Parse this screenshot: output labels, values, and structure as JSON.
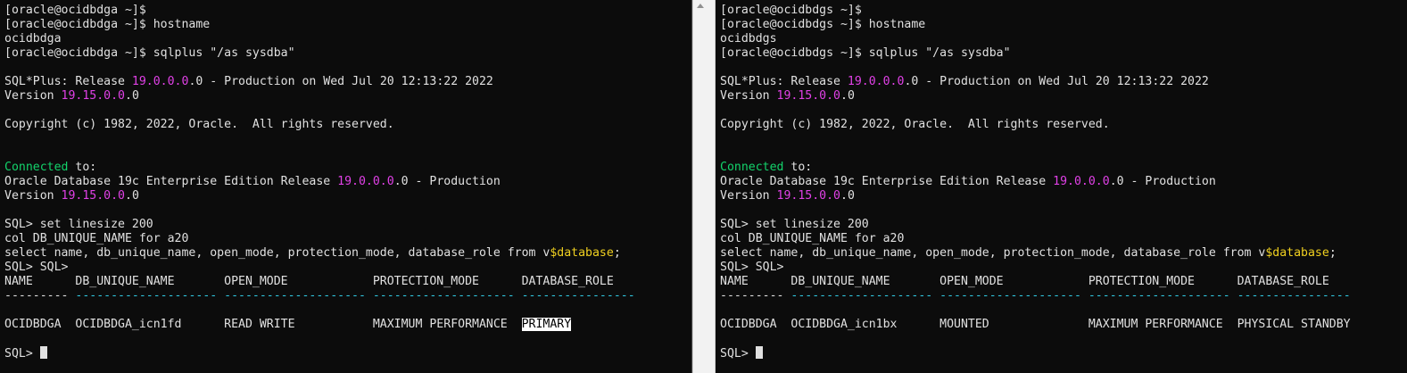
{
  "colors": {
    "background": "#0c0c0c",
    "text": "#e0e0e0",
    "connected": "#13d36b",
    "version_number": "#e040e6",
    "database_variable": "#f0d020",
    "separator": "#30c8e0",
    "selection": "#ffffff"
  },
  "left": {
    "prompt_empty": "[oracle@ocidbdga ~]$",
    "prompt_hostname": "[oracle@ocidbdga ~]$ hostname",
    "hostname_output": "ocidbdga",
    "prompt_sqlplus": "[oracle@ocidbdga ~]$ sqlplus \"/as sysdba\"",
    "banner_prefix": "SQL*Plus: Release ",
    "banner_release": "19.0.0.0",
    "banner_suffix": ".0 - Production on Wed Jul 20 12:13:22 2022",
    "version_prefix": "Version ",
    "version_number": "19.15.0.0",
    "version_suffix": ".0",
    "copyright": "Copyright (c) 1982, 2022, Oracle.  All rights reserved.",
    "connected_word": "Connected",
    "connected_rest": " to:",
    "edition_prefix": "Oracle Database 19c Enterprise Edition Release ",
    "edition_release": "19.0.0.0",
    "edition_suffix": ".0 - Production",
    "version2_prefix": "Version ",
    "version2_number": "19.15.0.0",
    "version2_suffix": ".0",
    "cmd_linesize": "SQL> set linesize 200",
    "cmd_col": "col DB_UNIQUE_NAME for a20",
    "cmd_select_prefix": "select name, db_unique_name, open_mode, protection_mode, database_role from v",
    "cmd_select_var": "$database",
    "cmd_select_suffix": ";",
    "prompt_double": "SQL> SQL>",
    "header": "NAME      DB_UNIQUE_NAME       OPEN_MODE            PROTECTION_MODE      DATABASE_ROLE",
    "separator_white": "---------",
    "separator_cyan": " -------------------- -------------------- -------------------- ----------------",
    "row_prefix": "OCIDBDGA  OCIDBDGA_icn1fd      READ WRITE           MAXIMUM PERFORMANCE  ",
    "row_role": "PRIMARY",
    "final_prompt": "SQL> "
  },
  "right": {
    "prompt_empty": "[oracle@ocidbdgs ~]$",
    "prompt_hostname": "[oracle@ocidbdgs ~]$ hostname",
    "hostname_output": "ocidbdgs",
    "prompt_sqlplus": "[oracle@ocidbdgs ~]$ sqlplus \"/as sysdba\"",
    "banner_prefix": "SQL*Plus: Release ",
    "banner_release": "19.0.0.0",
    "banner_suffix": ".0 - Production on Wed Jul 20 12:13:22 2022",
    "version_prefix": "Version ",
    "version_number": "19.15.0.0",
    "version_suffix": ".0",
    "copyright": "Copyright (c) 1982, 2022, Oracle.  All rights reserved.",
    "connected_word": "Connected",
    "connected_rest": " to:",
    "edition_prefix": "Oracle Database 19c Enterprise Edition Release ",
    "edition_release": "19.0.0.0",
    "edition_suffix": ".0 - Production",
    "version2_prefix": "Version ",
    "version2_number": "19.15.0.0",
    "version2_suffix": ".0",
    "cmd_linesize": "SQL> set linesize 200",
    "cmd_col": "col DB_UNIQUE_NAME for a20",
    "cmd_select_prefix": "select name, db_unique_name, open_mode, protection_mode, database_role from v",
    "cmd_select_var": "$database",
    "cmd_select_suffix": ";",
    "prompt_double": "SQL> SQL>",
    "header": "NAME      DB_UNIQUE_NAME       OPEN_MODE            PROTECTION_MODE      DATABASE_ROLE",
    "separator_white": "---------",
    "separator_cyan": " -------------------- -------------------- -------------------- ----------------",
    "row_prefix": "OCIDBDGA  OCIDBDGA_icn1bx      MOUNTED              MAXIMUM PERFORMANCE  ",
    "row_role": "PHYSICAL STANDBY",
    "final_prompt": "SQL> "
  }
}
